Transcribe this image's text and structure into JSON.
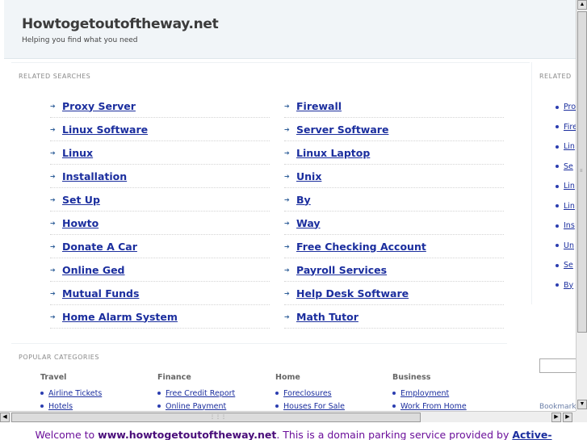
{
  "site": {
    "title": "Howtogetoutoftheway.net",
    "tagline": "Helping you find what you need"
  },
  "related": {
    "label": "RELATED SEARCHES",
    "left": [
      "Proxy Server",
      "Linux Software",
      "Linux",
      "Installation",
      "Set Up",
      "Howto",
      "Donate A Car",
      "Online Ged",
      "Mutual Funds",
      "Home Alarm System"
    ],
    "right": [
      "Firewall",
      "Server Software",
      "Linux Laptop",
      "Unix",
      "By",
      "Way",
      "Free Checking Account",
      "Payroll Services",
      "Help Desk Software",
      "Math Tutor"
    ]
  },
  "popular": {
    "label": "POPULAR CATEGORIES",
    "categories": [
      {
        "title": "Travel",
        "items": [
          "Airline Tickets",
          "Hotels"
        ]
      },
      {
        "title": "Finance",
        "items": [
          "Free Credit Report",
          "Online Payment"
        ]
      },
      {
        "title": "Home",
        "items": [
          "Foreclosures",
          "Houses For Sale"
        ]
      },
      {
        "title": "Business",
        "items": [
          "Employment",
          "Work From Home"
        ]
      }
    ]
  },
  "sidebar": {
    "label": "RELATED",
    "items": [
      "Pro",
      "Fire",
      "Lin",
      "Se",
      "Lin",
      "Lin",
      "Ins",
      "Un",
      "Se",
      "By"
    ],
    "bookmark": "Bookmark"
  },
  "footer": {
    "prefix": "Welcome to ",
    "domain": "www.howtogetoutoftheway.net",
    "middle": ". This is a domain parking service provided by ",
    "link": "Active-"
  }
}
